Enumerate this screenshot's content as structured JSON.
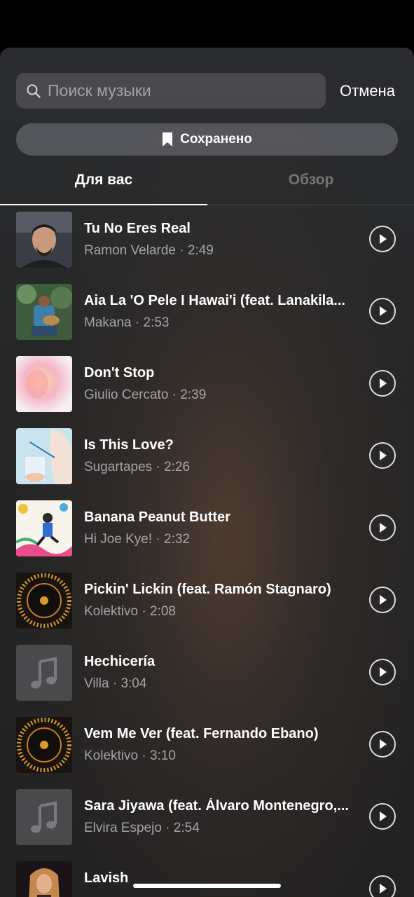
{
  "search": {
    "placeholder": "Поиск музыки",
    "value": "",
    "cancel_label": "Отмена"
  },
  "saved": {
    "label": "Сохранено"
  },
  "tabs": [
    {
      "label": "Для вас",
      "active": true
    },
    {
      "label": "Обзор",
      "active": false
    }
  ],
  "tracks": [
    {
      "title": "Tu No Eres Real",
      "artist": "Ramon Velarde",
      "duration": "2:49",
      "cover": "portrait-man"
    },
    {
      "title": "Aia La 'O Pele I Hawai'i (feat. Lanakila...",
      "artist": "Makana",
      "duration": "2:53",
      "cover": "ukulele-player"
    },
    {
      "title": "Don't Stop",
      "artist": "Giulio Cercato",
      "duration": "2:39",
      "cover": "pastel-blur"
    },
    {
      "title": "Is This Love?",
      "artist": "Sugartapes",
      "duration": "2:26",
      "cover": "glass-straw"
    },
    {
      "title": "Banana Peanut Butter",
      "artist": "Hi Joe Kye!",
      "duration": "2:32",
      "cover": "colorful-jump"
    },
    {
      "title": "Pickin' Lickin (feat. Ramón Stagnaro)",
      "artist": "Kolektivo",
      "duration": "2:08",
      "cover": "kolektivo-logo"
    },
    {
      "title": "Hechicería",
      "artist": "Villa",
      "duration": "3:04",
      "cover": "music-note-placeholder"
    },
    {
      "title": "Vem Me Ver (feat. Fernando Ebano)",
      "artist": "Kolektivo",
      "duration": "3:10",
      "cover": "kolektivo-logo"
    },
    {
      "title": "Sara Jiyawa (feat. Álvaro Montenegro,...",
      "artist": "Elvira Espejo",
      "duration": "2:54",
      "cover": "music-note-placeholder"
    },
    {
      "title": "Lavish",
      "artist": "",
      "duration": "",
      "cover": "singer-portrait"
    }
  ]
}
